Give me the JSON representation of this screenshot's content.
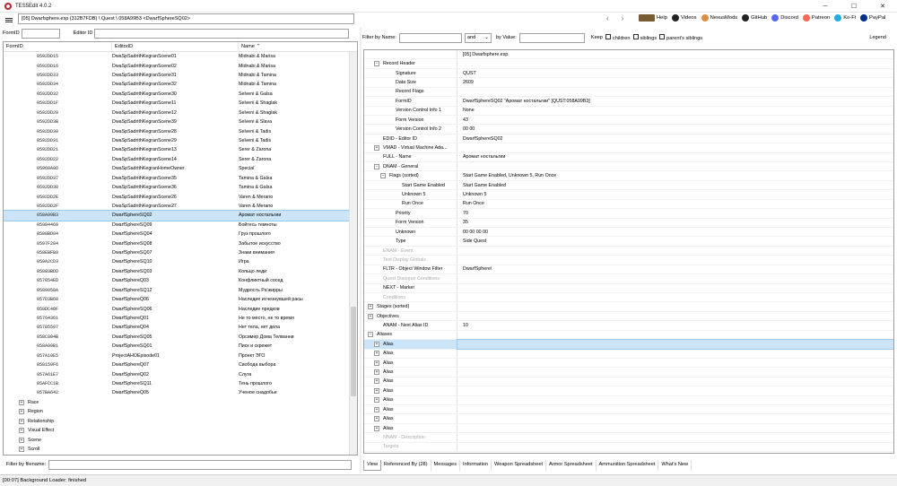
{
  "window": {
    "title": "TES5Edit 4.0.2",
    "minimize": "─",
    "maximize": "☐",
    "close": "✕"
  },
  "path": "[05] Dwarfsphere.esp (312B7FDB) \\ Quest \\ 058A99B3 <DwarfSphereSQ02>",
  "toolbar_links": [
    {
      "label": "Help",
      "icon": "book-icon",
      "color": "#7a5c33"
    },
    {
      "label": "Videos",
      "icon": "video-icon",
      "color": "#222222"
    },
    {
      "label": "NexusMods",
      "icon": "nexusmods-icon",
      "color": "#d98f40"
    },
    {
      "label": "GitHub",
      "icon": "github-icon",
      "color": "#222222"
    },
    {
      "label": "Discord",
      "icon": "discord-icon",
      "color": "#5865f2"
    },
    {
      "label": "Patreon",
      "icon": "patreon-icon",
      "color": "#f96854"
    },
    {
      "label": "Ko-Fi",
      "icon": "kofi-icon",
      "color": "#29abe0"
    },
    {
      "label": "PayPal",
      "icon": "paypal-icon",
      "color": "#003087"
    }
  ],
  "left_filter": {
    "formid_label": "FormID",
    "editorid_label": "Editor ID"
  },
  "left_columns": [
    "FormID",
    "EditorID",
    "Name"
  ],
  "left_rows": [
    [
      "0592DD15",
      "DwaSpSadrithKegranScene01",
      "Midnabi & Marisa"
    ],
    [
      "0592DD16",
      "DwaSpSadrithKegranScene02",
      "Midnabi & Marisa"
    ],
    [
      "0592DD33",
      "DwaSpSadrithKegranScene31",
      "Midnabi & Tamina"
    ],
    [
      "0592DD34",
      "DwaSpSadrithKegranScene32",
      "Midnabi & Tamina"
    ],
    [
      "0592DD32",
      "DwaSpSadrithKegranScene30",
      "Selveni & Galsa"
    ],
    [
      "0592DD1F",
      "DwaSpSadrithKegranScene11",
      "Selveni & Shaglak"
    ],
    [
      "0592DD20",
      "DwaSpSadrithKegranScene12",
      "Selveni & Shaglak"
    ],
    [
      "0592DD3B",
      "DwaSpSadrithKegranScene39",
      "Selveni & Slava"
    ],
    [
      "0592DD30",
      "DwaSpSadrithKegranScene28",
      "Selveni & Tadis"
    ],
    [
      "0592DD31",
      "DwaSpSadrithKegranScene29",
      "Selveni & Tadis"
    ],
    [
      "0592DD21",
      "DwaSpSadrithKegranScene13",
      "Serer & Zarona"
    ],
    [
      "0592DD22",
      "DwaSpSadrithKegranScene14",
      "Serer & Zarona"
    ],
    [
      "05960A0D",
      "DwaSpSadrithKegranHomeOwner",
      "Special"
    ],
    [
      "0592DD37",
      "DwaSpSadrithKegranScene35",
      "Tamina & Galsa"
    ],
    [
      "0592DD38",
      "DwaSpSadrithKegranScene36",
      "Tamina & Galsa"
    ],
    [
      "0592DD2E",
      "DwaSpSadrithKegranScene26",
      "Varen & Merano"
    ],
    [
      "0592DD2F",
      "DwaSpSadrithKegranScene27",
      "Varen & Merano"
    ],
    [
      "058A99B3",
      "DwarfSphereSQ02",
      "Аромат ностальгии"
    ],
    [
      "05984460",
      "DwarfSphereSQ09",
      "Бойтесь темноты"
    ],
    [
      "0588BD04",
      "DwarfSphereSQ04",
      "Груз прошлого"
    ],
    [
      "0597F284",
      "DwarfSphereSQ08",
      "Забытое искусство"
    ],
    [
      "058EBFB9",
      "DwarfSphereSQ07",
      "Знаки внимания"
    ],
    [
      "059A2CD3",
      "DwarfSphereSQ10",
      "Игра"
    ],
    [
      "05883BDD",
      "DwarfSphereSQ03",
      "Кольцо леди"
    ],
    [
      "057854ED",
      "DwarfSphereQ03",
      "Конфликтный сосед"
    ],
    [
      "0589058A",
      "DwarfSphereSQ12",
      "Мудрость Ра'жирры"
    ],
    [
      "057D3B68",
      "DwarfSphereQ06",
      "Наследие исчезнувшей расы"
    ],
    [
      "058DC48F",
      "DwarfSphereSQ06",
      "Наследие предков"
    ],
    [
      "05764361",
      "DwarfSphereQ01",
      "Не то место, не то время"
    ],
    [
      "05785507",
      "DwarfSphereQ04",
      "Нет тела, нет дела"
    ],
    [
      "058C804B",
      "DwarfSphereSQ05",
      "Орсимер Дома Телванни"
    ],
    [
      "058A99B1",
      "DwarfSphereSQ01",
      "Писк и скрежет"
    ],
    [
      "057A10E5",
      "ProjectAHOEpisode01",
      "Проект ЭГО"
    ],
    [
      "058159F6",
      "DwarfSphereQ07",
      "Свобода выбора"
    ],
    [
      "057A61E7",
      "DwarfSphereQ02",
      "Слуга"
    ],
    [
      "05AFCC1B",
      "DwarfSphereSQ11",
      "Тень прошлого"
    ],
    [
      "057BA642",
      "DwarfSphereQ05",
      "Ученое снадобье"
    ]
  ],
  "left_selected_index": 17,
  "left_groups": [
    "Race",
    "Region",
    "Relationship",
    "Visual Effect",
    "Scene",
    "Scroll"
  ],
  "bottom_filter_label": "Filter by filename:",
  "status": "[00:07] Background Loader: finished",
  "right_filter": {
    "by_name": "Filter by Name:",
    "op": "and",
    "by_value": "by Value:",
    "keep": "Keep",
    "children": "children",
    "siblings": "siblings",
    "parents_siblings": "parent's siblings",
    "legend": "Legend"
  },
  "right_header_value": "[05] Dwarfsphere.esp",
  "right_rows": [
    {
      "indent": 1,
      "exp": "-",
      "k": "Record Header",
      "v": ""
    },
    {
      "indent": 3,
      "exp": "",
      "k": "Signature",
      "v": "QUST"
    },
    {
      "indent": 3,
      "exp": "",
      "k": "Data Size",
      "v": "2609"
    },
    {
      "indent": 3,
      "exp": "",
      "k": "Record Flags",
      "v": ""
    },
    {
      "indent": 3,
      "exp": "",
      "k": "FormID",
      "v": "DwarfSphereSQ02 \"Аромат ностальгии\" [QUST:058A99B3]"
    },
    {
      "indent": 3,
      "exp": "",
      "k": "Version Control Info 1",
      "v": "None"
    },
    {
      "indent": 3,
      "exp": "",
      "k": "Form Version",
      "v": "43"
    },
    {
      "indent": 3,
      "exp": "",
      "k": "Version Control Info 2",
      "v": "00 00"
    },
    {
      "indent": 1,
      "exp": "",
      "k": "EDID - Editor ID",
      "v": "DwarfSphereSQ02"
    },
    {
      "indent": 1,
      "exp": "+",
      "k": "VMAD - Virtual Machine Ada...",
      "v": ""
    },
    {
      "indent": 1,
      "exp": "",
      "k": "FULL - Name",
      "v": "Аромат ностальгии"
    },
    {
      "indent": 1,
      "exp": "-",
      "k": "DNAM - General",
      "v": ""
    },
    {
      "indent": 2,
      "exp": "-",
      "k": "Flags (sorted)",
      "v": "Start Game Enabled, Unknown 5, Run Once"
    },
    {
      "indent": 4,
      "exp": "",
      "k": "Start Game Enabled",
      "v": "Start Game Enabled"
    },
    {
      "indent": 4,
      "exp": "",
      "k": "Unknown 5",
      "v": "Unknown 5"
    },
    {
      "indent": 4,
      "exp": "",
      "k": "Run Once",
      "v": "Run Once"
    },
    {
      "indent": 3,
      "exp": "",
      "k": "Priority",
      "v": "70"
    },
    {
      "indent": 3,
      "exp": "",
      "k": "Form Version",
      "v": "35"
    },
    {
      "indent": 3,
      "exp": "",
      "k": "Unknown",
      "v": "00 00 00 00"
    },
    {
      "indent": 3,
      "exp": "",
      "k": "Type",
      "v": "Side Quest"
    },
    {
      "indent": 1,
      "exp": "",
      "k": "ENAM - Event",
      "v": "",
      "dim": true
    },
    {
      "indent": 1,
      "exp": "",
      "k": "Text Display Globals",
      "v": "",
      "dim": true
    },
    {
      "indent": 1,
      "exp": "",
      "k": "FLTR - Object Window Filter",
      "v": "DwarfSphere\\"
    },
    {
      "indent": 1,
      "exp": "",
      "k": "Quest Dialogue Conditions",
      "v": "",
      "dim": true
    },
    {
      "indent": 1,
      "exp": "",
      "k": "NEXT - Marker",
      "v": ""
    },
    {
      "indent": 1,
      "exp": "",
      "k": "Conditions",
      "v": "",
      "dim": true
    },
    {
      "indent": 0,
      "exp": "+",
      "k": "Stages (sorted)",
      "v": ""
    },
    {
      "indent": 0,
      "exp": "+",
      "k": "Objectives",
      "v": ""
    },
    {
      "indent": 1,
      "exp": "",
      "k": "ANAM - Next Alias ID",
      "v": "10"
    },
    {
      "indent": 0,
      "exp": "-",
      "k": "Aliases",
      "v": ""
    },
    {
      "indent": 1,
      "exp": "+",
      "k": "Alias",
      "v": "",
      "sel": true
    },
    {
      "indent": 1,
      "exp": "+",
      "k": "Alias",
      "v": ""
    },
    {
      "indent": 1,
      "exp": "+",
      "k": "Alias",
      "v": ""
    },
    {
      "indent": 1,
      "exp": "+",
      "k": "Alias",
      "v": ""
    },
    {
      "indent": 1,
      "exp": "+",
      "k": "Alias",
      "v": ""
    },
    {
      "indent": 1,
      "exp": "+",
      "k": "Alias",
      "v": ""
    },
    {
      "indent": 1,
      "exp": "+",
      "k": "Alias",
      "v": ""
    },
    {
      "indent": 1,
      "exp": "+",
      "k": "Alias",
      "v": ""
    },
    {
      "indent": 1,
      "exp": "+",
      "k": "Alias",
      "v": ""
    },
    {
      "indent": 1,
      "exp": "+",
      "k": "Alias",
      "v": ""
    },
    {
      "indent": 1,
      "exp": "",
      "k": "NNAM - Description",
      "v": "",
      "dim": true
    },
    {
      "indent": 1,
      "exp": "",
      "k": "Targets",
      "v": "",
      "dim": true
    }
  ],
  "tabs": [
    "View",
    "Referenced By (28)",
    "Messages",
    "Information",
    "Weapon Spreadsheet",
    "Armor Spreadsheet",
    "Ammunition Spreadsheet",
    "What's New"
  ],
  "active_tab": 0
}
